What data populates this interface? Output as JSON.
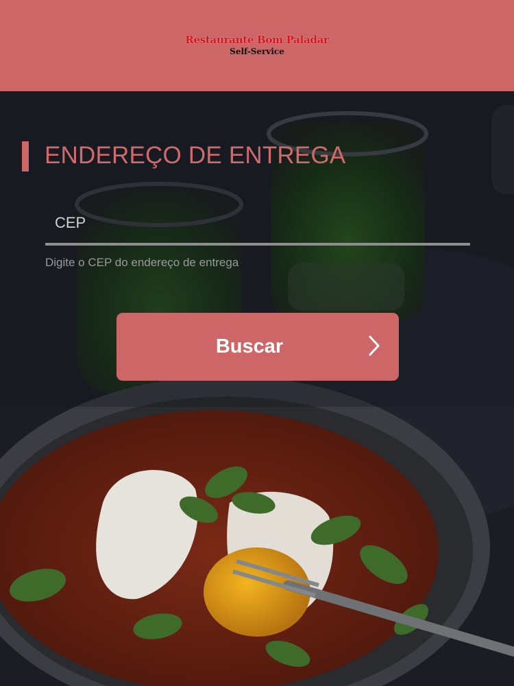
{
  "header": {
    "logo_name": "Restaurante Bom Paladar",
    "logo_subtitle": "Self-Service",
    "background_color": "#cd6767"
  },
  "form": {
    "section_title": "ENDEREÇO DE ENTREGA",
    "cep_placeholder": "CEP",
    "cep_value": "",
    "cep_hint": "Digite o CEP do endereço de entrega",
    "search_button_label": "Buscar",
    "search_button_icon": "chevron-right-icon",
    "accent_color": "#cd6767"
  },
  "background": {
    "image": "food-photo"
  }
}
